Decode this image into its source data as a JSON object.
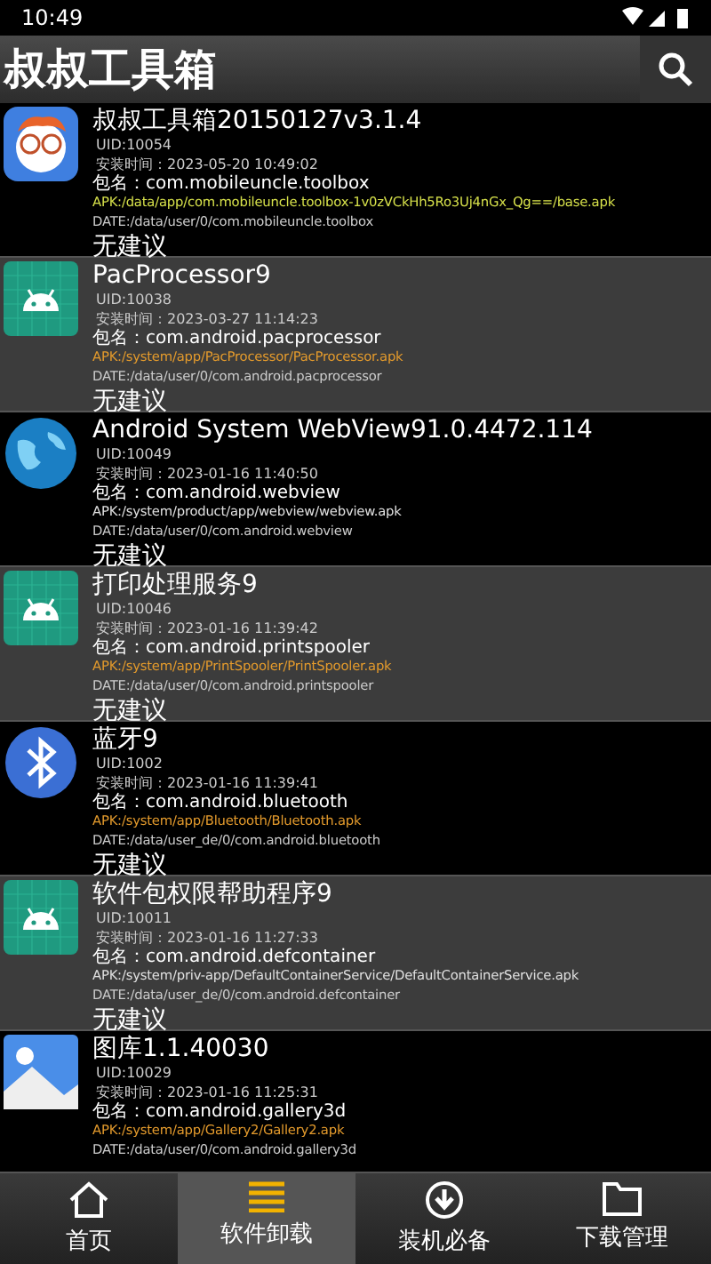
{
  "status_bar": {
    "time": "10:49"
  },
  "app_bar": {
    "title": "叔叔工具箱"
  },
  "apps": [
    {
      "kind": "mascot",
      "name": "叔叔工具箱20150127v3.1.4",
      "uid": "UID:10054",
      "installed": "安装时间：2023-05-20 10:49:02",
      "package": "包名：com.mobileuncle.toolbox",
      "apk": "APK:/data/app/com.mobileuncle.toolbox-1v0zVCkHh5Ro3Uj4nGx_Qg==/base.apk",
      "color": "#d6e04a",
      "data": "DATE:/data/user/0/com.mobileuncle.toolbox",
      "advice": "无建议"
    },
    {
      "kind": "android",
      "name": "PacProcessor9",
      "uid": "UID:10038",
      "installed": "安装时间：2023-03-27 11:14:23",
      "package": "包名：com.android.pacprocessor",
      "apk": "APK:/system/app/PacProcessor/PacProcessor.apk",
      "color": "#e39a2c",
      "data": "DATE:/data/user/0/com.android.pacprocessor",
      "advice": "无建议"
    },
    {
      "kind": "globe",
      "name": "Android System WebView91.0.4472.114",
      "uid": "UID:10049",
      "installed": "安装时间：2023-01-16 11:40:50",
      "package": "包名：com.android.webview",
      "apk": "APK:/system/product/app/webview/webview.apk",
      "color": "#e0e0e0",
      "data": "DATE:/data/user/0/com.android.webview",
      "advice": "无建议"
    },
    {
      "kind": "android",
      "name": "打印处理服务9",
      "uid": "UID:10046",
      "installed": "安装时间：2023-01-16 11:39:42",
      "package": "包名：com.android.printspooler",
      "apk": "APK:/system/app/PrintSpooler/PrintSpooler.apk",
      "color": "#e39a2c",
      "data": "DATE:/data/user/0/com.android.printspooler",
      "advice": "无建议"
    },
    {
      "kind": "bluetooth",
      "name": "蓝牙9",
      "uid": "UID:1002",
      "installed": "安装时间：2023-01-16 11:39:41",
      "package": "包名：com.android.bluetooth",
      "apk": "APK:/system/app/Bluetooth/Bluetooth.apk",
      "color": "#e39a2c",
      "data": "DATE:/data/user_de/0/com.android.bluetooth",
      "advice": "无建议"
    },
    {
      "kind": "android",
      "name": "软件包权限帮助程序9",
      "uid": "UID:10011",
      "installed": "安装时间：2023-01-16 11:27:33",
      "package": "包名：com.android.defcontainer",
      "apk": "APK:/system/priv-app/DefaultContainerService/DefaultContainerService.apk",
      "color": "#e0e0e0",
      "data": "DATE:/data/user_de/0/com.android.defcontainer",
      "advice": "无建议"
    },
    {
      "kind": "gallery",
      "name": "图库1.1.40030",
      "uid": "UID:10029",
      "installed": "安装时间：2023-01-16 11:25:31",
      "package": "包名：com.android.gallery3d",
      "apk": "APK:/system/app/Gallery2/Gallery2.apk",
      "color": "#e39a2c",
      "data": "DATE:/data/user/0/com.android.gallery3d"
    }
  ],
  "nav": [
    {
      "kind": "home",
      "label": "首页",
      "selected": false
    },
    {
      "kind": "list",
      "label": "软件卸载",
      "selected": true
    },
    {
      "kind": "download",
      "label": "装机必备",
      "selected": false
    },
    {
      "kind": "folder",
      "label": "下载管理",
      "selected": false
    }
  ]
}
